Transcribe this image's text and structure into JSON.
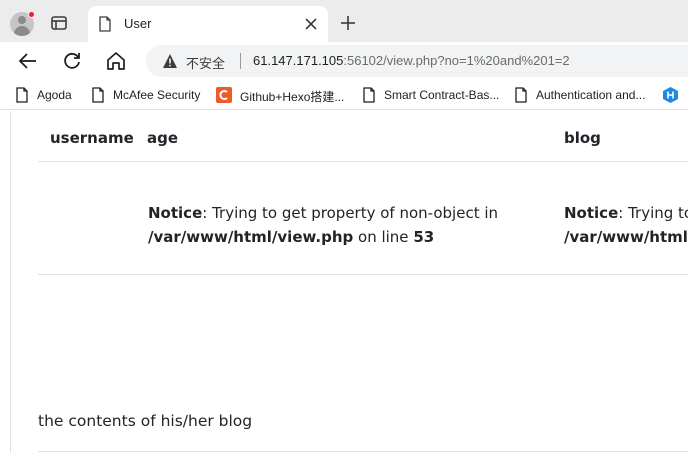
{
  "browser": {
    "tab": {
      "title": "User"
    },
    "address_bar": {
      "security_label": "不安全",
      "url_host": "61.147.171.105",
      "url_rest": ":56102/view.php?no=1%20and%201=2"
    },
    "bookmarks": [
      {
        "label": "Agoda",
        "icon": "page-icon"
      },
      {
        "label": "McAfee Security",
        "icon": "page-icon"
      },
      {
        "label": "Github+Hexo搭建...",
        "icon": "c-logo-icon"
      },
      {
        "label": "Smart Contract-Bas...",
        "icon": "page-icon"
      },
      {
        "label": "Authentication and...",
        "icon": "page-icon"
      },
      {
        "label": "",
        "icon": "hexagon-h-icon"
      }
    ],
    "colors": {
      "brand_red": "#e0262e",
      "bookmark_c_logo": "#f05a28",
      "bookmark_h_logo": "#1e88e5"
    }
  },
  "page": {
    "table": {
      "headers": [
        "username",
        "age",
        "blog"
      ],
      "notice": {
        "label": "Notice",
        "message": ": Trying to get property of non-object in",
        "path": "/var/www/html/view.php",
        "on_line": " on line ",
        "line": "53"
      },
      "notice_blog": {
        "label": "Notice",
        "message": ": Trying to",
        "path": "/var/www/html/"
      }
    },
    "blog_contents": "the contents of his/her blog"
  }
}
